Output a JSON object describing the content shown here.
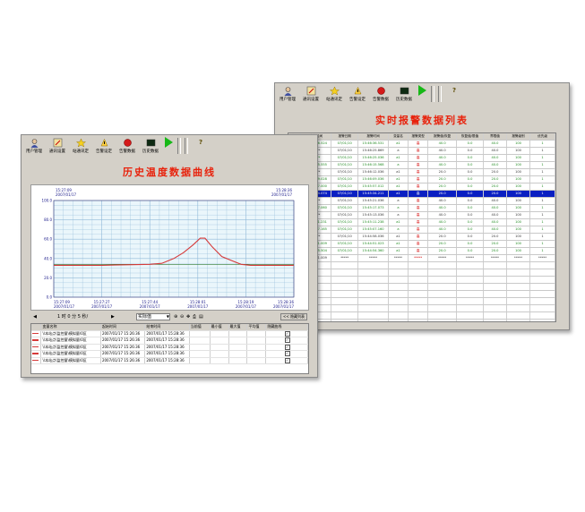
{
  "realtime_window": {
    "toolbar": [
      {
        "label": "用户管理",
        "icon": "user-management-icon"
      },
      {
        "label": "通讯设置",
        "icon": "communication-settings-icon"
      },
      {
        "label": "站通讯定",
        "icon": "station-settings-icon"
      },
      {
        "label": "告警设定",
        "icon": "alarm-settings-icon"
      },
      {
        "label": "告警数据",
        "icon": "alarm-data-icon"
      },
      {
        "label": "历史数据",
        "icon": "history-data-icon"
      }
    ],
    "title": "实时报警数据列表",
    "table": {
      "headers": [
        "序号",
        "事件时间",
        "报警日期",
        "报警时间",
        "变量名",
        "报警类型",
        "报警值/恢复",
        "恢复值/限值",
        "界限值",
        "报警级别",
        "优先级"
      ],
      "rows": [
        {
          "c": [
            "1",
            "15:46:36.524",
            "07/01/10",
            "15:46:36.531",
            "a1",
            "高",
            "40.0",
            "0.0",
            "40.0",
            "100",
            "1"
          ],
          "style": "green"
        },
        {
          "c": [
            "2",
            "*****",
            "07/01/10",
            "15:46:25.869",
            "a",
            "高",
            "40.0",
            "0.0",
            "40.0",
            "100",
            "1"
          ],
          "style": "gray"
        },
        {
          "c": [
            "3",
            "*****",
            "07/01/10",
            "15:46:25.036",
            "a1",
            "高",
            "40.0",
            "0.0",
            "40.0",
            "100",
            "1"
          ],
          "style": "green"
        },
        {
          "c": [
            "4",
            "15:46:15.555",
            "07/01/10",
            "15:46:15.568",
            "a",
            "高",
            "40.0",
            "0.0",
            "40.0",
            "100",
            "1"
          ],
          "style": "green"
        },
        {
          "c": [
            "5",
            "*****",
            "07/01/10",
            "15:46:12.036",
            "a1",
            "高",
            "20.0",
            "0.0",
            "20.0",
            "100",
            "1"
          ],
          "style": "gray"
        },
        {
          "c": [
            "6",
            "15:46:09.028",
            "07/01/10",
            "15:46:09.036",
            "a1",
            "高",
            "20.0",
            "0.0",
            "20.0",
            "100",
            "1"
          ],
          "style": "green"
        },
        {
          "c": [
            "7",
            "15:45:57.000",
            "07/01/10",
            "15:45:57.012",
            "a1",
            "高",
            "20.0",
            "0.0",
            "20.0",
            "100",
            "1"
          ],
          "style": "green"
        },
        {
          "c": [
            "8",
            "15:45:34.074",
            "07/01/10",
            "15:45:34.211",
            "a1",
            "高",
            "20.0",
            "0.0",
            "20.0",
            "100",
            "1"
          ],
          "style": "sel"
        },
        {
          "c": [
            "9",
            "*****",
            "07/01/10",
            "15:45:21.036",
            "a",
            "高",
            "40.0",
            "0.0",
            "40.0",
            "100",
            "1"
          ],
          "style": "gray"
        },
        {
          "c": [
            "10",
            "15:45:17.060",
            "07/01/10",
            "15:45:17.073",
            "a",
            "高",
            "40.0",
            "0.0",
            "40.0",
            "100",
            "1"
          ],
          "style": "green"
        },
        {
          "c": [
            "11",
            "*****",
            "07/01/10",
            "15:45:13.036",
            "a",
            "高",
            "40.0",
            "0.0",
            "40.0",
            "100",
            "1"
          ],
          "style": "gray"
        },
        {
          "c": [
            "12",
            "15:45:11.231",
            "07/01/10",
            "15:45:11.238",
            "a1",
            "高",
            "40.0",
            "0.0",
            "40.0",
            "100",
            "1"
          ],
          "style": "green"
        },
        {
          "c": [
            "13",
            "15:45:07.165",
            "07/01/10",
            "15:45:07.160",
            "a",
            "高",
            "40.0",
            "0.0",
            "40.0",
            "100",
            "1"
          ],
          "style": "green"
        },
        {
          "c": [
            "14",
            "*****",
            "07/01/10",
            "15:44:58.036",
            "a1",
            "高",
            "20.0",
            "0.0",
            "20.0",
            "100",
            "1"
          ],
          "style": "gray"
        },
        {
          "c": [
            "15",
            "15:44:51.009",
            "07/01/10",
            "15:44:51.023",
            "a1",
            "高",
            "20.0",
            "0.0",
            "20.0",
            "100",
            "1"
          ],
          "style": "green"
        },
        {
          "c": [
            "16",
            "15:44:55.504",
            "07/01/10",
            "15:44:54.360",
            "a1",
            "高",
            "20.0",
            "0.0",
            "20.0",
            "100",
            "1"
          ],
          "style": "green"
        },
        {
          "c": [
            "17",
            "15:44:51.009",
            "*****",
            "*****",
            "*****",
            "*****",
            "*****",
            "*****",
            "*****",
            "*****",
            "*****"
          ],
          "style": "gray"
        }
      ]
    }
  },
  "history_window": {
    "toolbar": [
      {
        "label": "用户管理",
        "icon": "user-management-icon"
      },
      {
        "label": "通讯设置",
        "icon": "communication-settings-icon"
      },
      {
        "label": "站通讯定",
        "icon": "station-settings-icon"
      },
      {
        "label": "告警设定",
        "icon": "alarm-settings-icon"
      },
      {
        "label": "告警数据",
        "icon": "alarm-data-icon"
      },
      {
        "label": "历史数据",
        "icon": "history-data-icon"
      }
    ],
    "title": "历史温度数据曲线",
    "corner_left": {
      "time": "15:27:09",
      "date": "2007/01/17"
    },
    "corner_right": {
      "time": "15:28:36",
      "date": "2007/01/17"
    },
    "nav": {
      "page_info": "1 时 0 分 5 秒/",
      "range_label": "实际值",
      "hide_list": "<< 隐藏列表"
    },
    "legend_table": {
      "headers": [
        "",
        "变量名称",
        "起始时间",
        "结束时间",
        "当前值",
        "最小值",
        "最大值",
        "平均值",
        "隐藏曲线"
      ],
      "rows": [
        {
          "name": "\\\\本站点\\监控量\\模拟量\\0区",
          "start": "2007/01/17 15:26:36",
          "end": "2007/01/17 15:28:36",
          "checked": "✓"
        },
        {
          "name": "\\\\本站点\\监控量\\模拟量\\0区",
          "start": "2007/01/17 15:26:36",
          "end": "2007/01/17 15:28:36",
          "checked": "✓"
        },
        {
          "name": "\\\\本站点\\监控量\\模拟量\\0区",
          "start": "2007/01/17 15:26:36",
          "end": "2007/01/17 15:28:36",
          "checked": "✓"
        },
        {
          "name": "\\\\本站点\\监控量\\模拟量\\0区",
          "start": "2007/01/17 15:26:36",
          "end": "2007/01/17 15:28:36",
          "checked": "✓"
        },
        {
          "name": "\\\\本站点\\监控量\\模拟量\\0区",
          "start": "2007/01/17 15:26:36",
          "end": "2007/01/17 15:28:36",
          "checked": "✓"
        }
      ]
    },
    "colors": {
      "curve": "#d63a3a",
      "grid": "#8fb8d8",
      "plot_bg": "#eaf6fb",
      "baseline": "#2d7a2d"
    }
  },
  "chart_data": {
    "type": "line",
    "title": "历史温度数据曲线",
    "xlabel": "",
    "ylabel": "",
    "x": [
      "15:27:09",
      "15:27:27",
      "15:27:44",
      "15:28:01",
      "15:28:19",
      "15:28:36"
    ],
    "x_dates": [
      "2007/01/17",
      "2007/01/17",
      "2007/01/17",
      "2007/01/17",
      "2007/01/17",
      "2007/01/17"
    ],
    "yticks": [
      "0.0",
      "20.0",
      "40.0",
      "60.0",
      "80.0",
      "100.0"
    ],
    "ylim": [
      0,
      100
    ],
    "grid": true,
    "series": [
      {
        "xfrac": [
          0,
          0.1,
          0.2,
          0.3,
          0.4,
          0.45,
          0.5,
          0.54,
          0.58,
          0.61,
          0.63,
          0.66,
          0.7,
          0.74,
          0.78,
          0.82,
          0.9,
          1.0
        ],
        "values": [
          33,
          33,
          33,
          33.5,
          34,
          35,
          40,
          46,
          54,
          61,
          61,
          52,
          42,
          38,
          34,
          33,
          33,
          33
        ]
      },
      {
        "xfrac": [
          0,
          1.0
        ],
        "values": [
          34,
          34
        ]
      }
    ]
  }
}
